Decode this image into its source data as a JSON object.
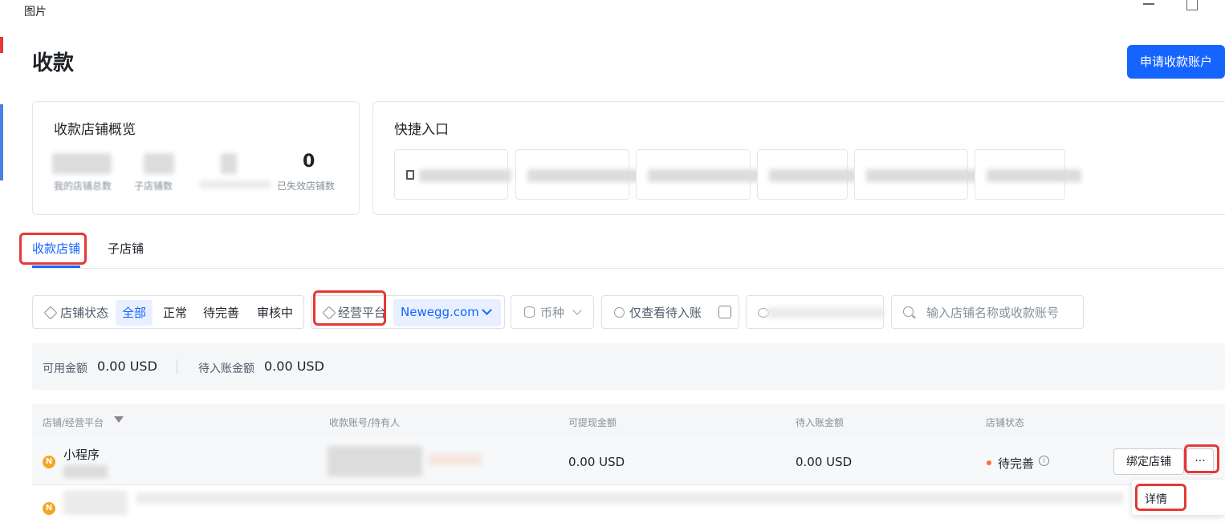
{
  "window": {
    "title": "图片"
  },
  "header": {
    "title": "收款",
    "apply_button": "申请收款账户"
  },
  "overview": {
    "title": "收款店铺概览",
    "stats": [
      {
        "value": "",
        "label": "我的店铺总数"
      },
      {
        "value": "",
        "label": "子店铺数"
      },
      {
        "value": "",
        "label": ""
      },
      {
        "value": "0",
        "label": "已失效店铺数"
      }
    ]
  },
  "quick_entry": {
    "title": "快捷入口"
  },
  "tabs": [
    {
      "label": "收款店铺",
      "active": true
    },
    {
      "label": "子店铺",
      "active": false
    }
  ],
  "filters": {
    "store_status_label": "店铺状态",
    "store_status_options": [
      "全部",
      "正常",
      "待完善",
      "审核中"
    ],
    "store_status_selected": "全部",
    "platform_label": "经营平台",
    "platform_value": "Newegg.com",
    "currency_label": "币种",
    "pending_only_label": "仅查看待入账",
    "search_placeholder": "输入店铺名称或收款账号"
  },
  "balance": {
    "available_label": "可用金额",
    "available_value": "0.00 USD",
    "pending_label": "待入账金额",
    "pending_value": "0.00 USD"
  },
  "table": {
    "headers": [
      "店铺/经营平台",
      "收款账号/持有人",
      "可提现金额",
      "待入账金额",
      "店铺状态"
    ],
    "rows": [
      {
        "platform_badge": "N",
        "store_name": "小程序",
        "withdrawable": "0.00 USD",
        "pending": "0.00 USD",
        "status": "待完善",
        "bind_button": "绑定店铺",
        "more_button": "···"
      },
      {
        "platform_badge": "N",
        "store_name": "",
        "withdrawable": "",
        "pending": "",
        "status": ""
      }
    ]
  },
  "dropdown": {
    "details": "详情"
  },
  "colors": {
    "primary": "#1664ff",
    "warning": "#f5a623",
    "highlight": "#e53935"
  }
}
